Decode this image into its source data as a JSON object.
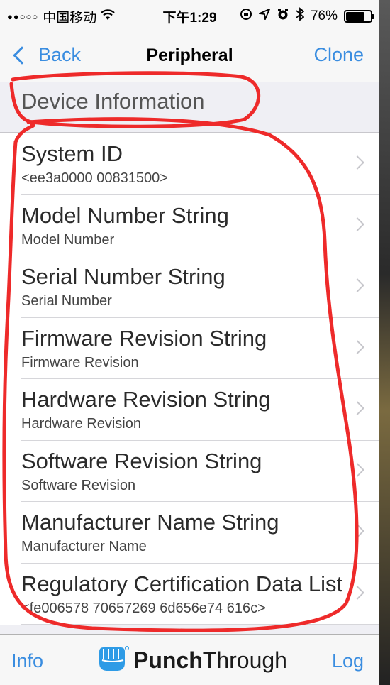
{
  "status_bar": {
    "signal": "●●○○○",
    "carrier": "中国移动",
    "time": "下午1:29",
    "icons": [
      "wifi-icon",
      "orientation-lock-icon",
      "location-icon",
      "alarm-icon",
      "bluetooth-icon"
    ],
    "battery_text": "76%",
    "battery_level": 0.76
  },
  "nav": {
    "back_label": "Back",
    "title": "Peripheral",
    "clone_label": "Clone"
  },
  "section": {
    "header": "Device Information"
  },
  "rows": [
    {
      "title": "System ID",
      "subtitle": "<ee3a0000 00831500>"
    },
    {
      "title": "Model Number String",
      "subtitle": "Model Number"
    },
    {
      "title": "Serial Number String",
      "subtitle": "Serial Number"
    },
    {
      "title": "Firmware Revision String",
      "subtitle": "Firmware Revision"
    },
    {
      "title": "Hardware Revision String",
      "subtitle": "Hardware Revision"
    },
    {
      "title": "Software Revision String",
      "subtitle": "Software Revision"
    },
    {
      "title": "Manufacturer Name String",
      "subtitle": "Manufacturer Name"
    },
    {
      "title": "Regulatory Certification Data List",
      "subtitle": "<fe006578 70657269 6d656e74 616c>"
    }
  ],
  "toolbar": {
    "info_label": "Info",
    "logo_bold": "Punch",
    "logo_regular": "Through",
    "log_label": "Log"
  },
  "colors": {
    "accent": "#3a8de0",
    "annotation": "#ee2a2a"
  }
}
